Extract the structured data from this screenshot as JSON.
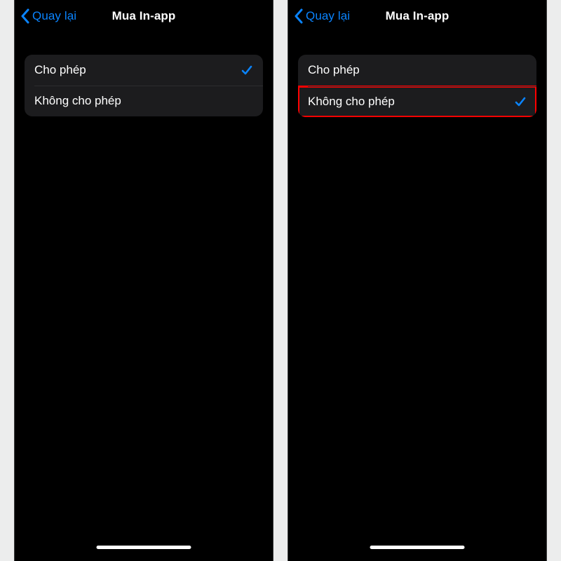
{
  "left": {
    "back_label": "Quay lại",
    "title": "Mua In-app",
    "options": [
      {
        "label": "Cho phép",
        "selected": true,
        "highlight": false
      },
      {
        "label": "Không cho phép",
        "selected": false,
        "highlight": false
      }
    ]
  },
  "right": {
    "back_label": "Quay lại",
    "title": "Mua In-app",
    "options": [
      {
        "label": "Cho phép",
        "selected": false,
        "highlight": false
      },
      {
        "label": "Không cho phép",
        "selected": true,
        "highlight": true
      }
    ]
  }
}
